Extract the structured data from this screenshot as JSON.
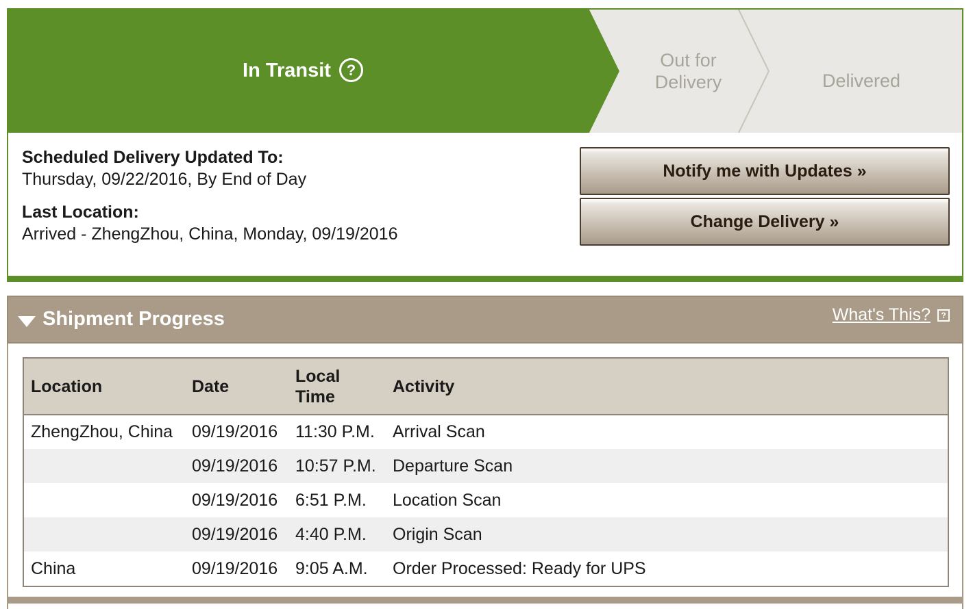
{
  "tracker": {
    "active_step": "In Transit",
    "help_icon": "question-circle-icon",
    "steps": [
      "Out for\nDelivery",
      "Delivered"
    ],
    "colors": {
      "active": "#5c8f28",
      "inactive": "#e9e8e4",
      "inactive_text": "#a7a49a"
    }
  },
  "delivery": {
    "scheduled_label": "Scheduled Delivery Updated To:",
    "scheduled_value": "Thursday, 09/22/2016, By End of Day",
    "last_location_label": "Last Location:",
    "last_location_value": "Arrived - ZhengZhou, China, Monday, 09/19/2016"
  },
  "buttons": {
    "notify": "Notify me with Updates »",
    "change": "Change Delivery »"
  },
  "progress": {
    "title": "Shipment Progress",
    "whats_this": "What's This?",
    "help_box": "?",
    "columns": [
      "Location",
      "Date",
      "Local Time",
      "Activity"
    ],
    "rows": [
      {
        "location": "ZhengZhou, China",
        "date": "09/19/2016",
        "time": "11:30 P.M.",
        "activity": "Arrival Scan"
      },
      {
        "location": "",
        "date": "09/19/2016",
        "time": "10:57 P.M.",
        "activity": "Departure Scan"
      },
      {
        "location": "",
        "date": "09/19/2016",
        "time": "6:51 P.M.",
        "activity": "Location Scan"
      },
      {
        "location": "",
        "date": "09/19/2016",
        "time": "4:40 P.M.",
        "activity": "Origin Scan"
      },
      {
        "location": "China",
        "date": "09/19/2016",
        "time": "9:05 A.M.",
        "activity": "Order Processed: Ready for UPS"
      }
    ]
  }
}
